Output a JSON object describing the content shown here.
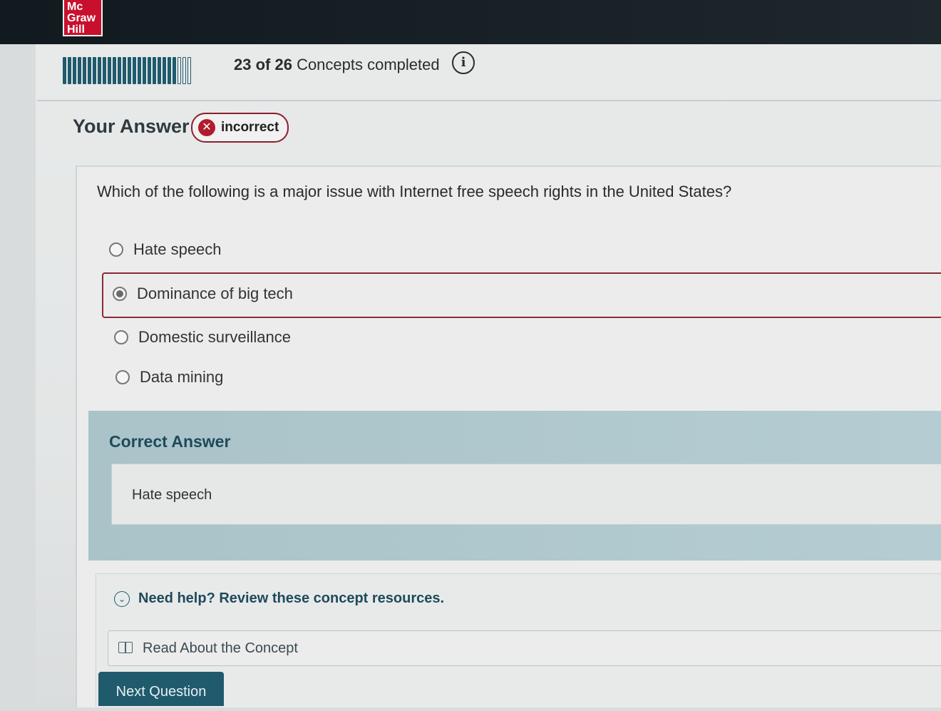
{
  "logo": {
    "lines": [
      "Mc",
      "Graw",
      "Hill"
    ]
  },
  "progress": {
    "completed": 23,
    "total": 26,
    "count_label": "23 of 26",
    "suffix_label": "Concepts completed",
    "info_icon": "info-circle-icon"
  },
  "your_answer": {
    "heading": "Your Answer",
    "badge_label": "incorrect",
    "badge_icon": "x-circle-icon",
    "badge_color": "#b01c2e"
  },
  "question": {
    "text": "Which of the following is a major issue with Internet free speech rights in the United States?",
    "options": [
      {
        "label": "Hate speech",
        "selected": false
      },
      {
        "label": "Dominance of big tech",
        "selected": true
      },
      {
        "label": "Domestic surveillance",
        "selected": false
      },
      {
        "label": "Data mining",
        "selected": false
      }
    ]
  },
  "correct_answer": {
    "heading": "Correct Answer",
    "value": "Hate speech"
  },
  "help": {
    "toggle_label": "Need help? Review these concept resources.",
    "toggle_icon": "chevron-down-circle-icon",
    "resource_label": "Read About the Concept",
    "resource_icon": "book-icon"
  },
  "actions": {
    "next_label": "Next Question"
  },
  "colors": {
    "accent": "#1f5a6d",
    "incorrect": "#8b1f2c",
    "brand_red": "#c8102e"
  }
}
